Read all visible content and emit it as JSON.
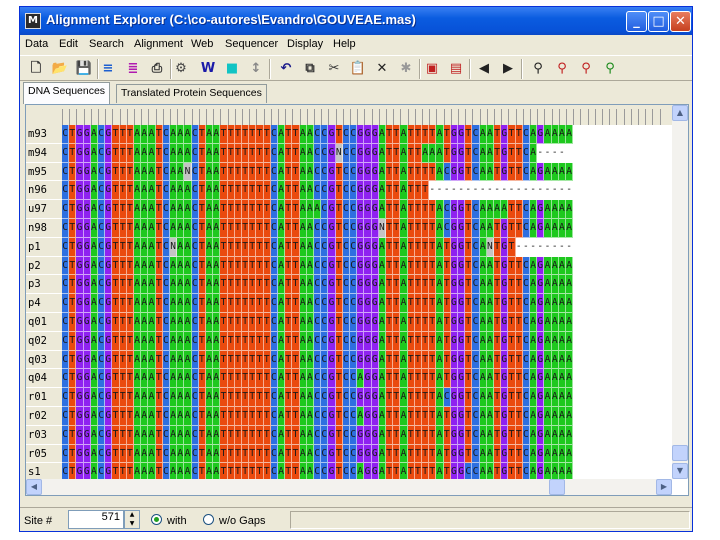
{
  "window": {
    "title": "Alignment Explorer (C:\\co-autores\\Evandro\\GOUVEAE.mas)",
    "icon_name": "mega-app-icon",
    "icon_glyph": "M",
    "minimize_glyph": "_",
    "maximize_glyph": "□",
    "close_glyph": "✕"
  },
  "menu": [
    "Data",
    "Edit",
    "Search",
    "Alignment",
    "Web",
    "Sequencer",
    "Display",
    "Help"
  ],
  "toolbar": [
    {
      "name": "new-file-icon",
      "glyph": "🗋",
      "color": "#333333"
    },
    {
      "name": "open-folder-icon",
      "glyph": "📂",
      "color": "#c48a17"
    },
    {
      "name": "save-disk-icon",
      "glyph": "💾",
      "color": "#2a2a7a"
    },
    {
      "name": "view-wordlist-icon",
      "glyph": "≡",
      "color": "#1d5fd0"
    },
    {
      "name": "align-sequences-icon",
      "glyph": "≣",
      "color": "#b01ab0"
    },
    {
      "name": "print-icon",
      "glyph": "⎙",
      "color": "#333333"
    },
    {
      "name": "translate-codons-icon",
      "glyph": "⚙",
      "color": "#444444"
    },
    {
      "name": "clustal-w-icon",
      "glyph": "W",
      "color": "#1a1aa8"
    },
    {
      "name": "muscle-icon",
      "glyph": "■",
      "color": "#11c4c4"
    },
    {
      "name": "mark-site-icon",
      "glyph": "↕",
      "color": "#888888"
    },
    {
      "name": "undo-icon",
      "glyph": "↶",
      "color": "#1a1a8a"
    },
    {
      "name": "copy-icon",
      "glyph": "⧉",
      "color": "#333333"
    },
    {
      "name": "cut-icon",
      "glyph": "✂",
      "color": "#333333"
    },
    {
      "name": "paste-icon",
      "glyph": "📋",
      "color": "#8a6a2a"
    },
    {
      "name": "delete-icon",
      "glyph": "✕",
      "color": "#222222"
    },
    {
      "name": "delete-gap-icon",
      "glyph": "✱",
      "color": "#999999"
    },
    {
      "name": "add-sequence-icon",
      "glyph": "▣",
      "color": "#c02020"
    },
    {
      "name": "edit-sequence-icon",
      "glyph": "▤",
      "color": "#c02020"
    },
    {
      "name": "previous-site-icon",
      "glyph": "◀",
      "color": "#222222"
    },
    {
      "name": "next-site-icon",
      "glyph": "▶",
      "color": "#222222"
    },
    {
      "name": "find-icon",
      "glyph": "⚲",
      "color": "#222222"
    },
    {
      "name": "find-previous-icon",
      "glyph": "⚲",
      "color": "#c02020"
    },
    {
      "name": "find-next-icon",
      "glyph": "⚲",
      "color": "#c02020"
    },
    {
      "name": "find-motif-icon",
      "glyph": "⚲",
      "color": "#1a8a1a"
    }
  ],
  "tabs": [
    "DNA Sequences",
    "Translated Protein Sequences"
  ],
  "base_colors": {
    "A": "#1ec81e",
    "C": "#2e6fe0",
    "G": "#8f22f0",
    "T": "#ea4a0e",
    "N": "#c4c4c4",
    "-": "#ffffff"
  },
  "sequences": [
    {
      "name": "m93",
      "seq": "CTGGACGTTTAAATCAAACTAATTTTTTTCATTAACCGTCCGGGATTATTTTATGGTCAATGTTCAGAAAA"
    },
    {
      "name": "m94",
      "seq": "CTGGACGTTTAAATCAAACTAATTTTTTTCATTAACCGNCCGGGATTATTAAATGGTCAATGTTCA----"
    },
    {
      "name": "m95",
      "seq": "CTGGACGTTTAAATCAANCTAATTTTTTTCATTAACCGTCCGGGATTATTTTACGGTCAATGTTCAGAAAA"
    },
    {
      "name": "n96",
      "seq": "CTGGACGTTTAAATCAAACTAATTTTTTTCATTAACCGTCCGGGATTATTT--------------------"
    },
    {
      "name": "u97",
      "seq": "CTGGACGTTTAAATCAAACTAATTTTTTTCATTAAACGTCCGGGATTATTTTACGGTCAAAATTCAGAAAA"
    },
    {
      "name": "n98",
      "seq": "CTGGACGTTTAAATCAAACTAATTTTTTTCATTAACCGTCCGGGNTTATTTTACGGTCAATGTTCAGAAAA"
    },
    {
      "name": "p1",
      "seq": "CTGGACGTTTAAATCNAACTAATTTTTTTCATTAACCGTCCGGGATTATTTTATGGTCANTGT--------"
    },
    {
      "name": "p2",
      "seq": "CTGGACGTTTAAATCAAACTAATTTTTTTCATTAACCGTCCGGGATTATTTTATGGTCAATGTTCAGAAAA"
    },
    {
      "name": "p3",
      "seq": "CTGGACGTTTAAATCAAACTAATTTTTTTCATTAACCGTCCGGGATTATTTTATGGTCAATGTTCAGAAAA"
    },
    {
      "name": "p4",
      "seq": "CTGGACGTTTAAATCAAACTAATTTTTTTCATTAACCGTCCGGGATTATTTTATGGTCAATGTTCAGAAAA"
    },
    {
      "name": "q01",
      "seq": "CTGGACGTTTAAATCAAACTAATTTTTTTCATTAACCGTCCGGGATTATTTTATGGTCAATGTTCAGAAAA"
    },
    {
      "name": "q02",
      "seq": "CTGGACGTTTAAATCAAACTAATTTTTTTCATTAACCGTCCGGGATTATTTTATGGTCAATGTTCAGAAAA"
    },
    {
      "name": "q03",
      "seq": "CTGGACGTTTAAATCAAACTAATTTTTTTCATTAACCGTCCGGGATTATTTTATGGTCAATGTTCAGAAAA"
    },
    {
      "name": "q04",
      "seq": "CTGGACGTTTAAATCAAACTAATTTTTTTCATTAACCGTCCAGGATTATTTTATGGTCAATGTTCAGAAAA"
    },
    {
      "name": "r01",
      "seq": "CTGGACGTTTAAATCAAACTAATTTTTTTCATTAACCGTCCGGGATTATTTTACGGTCAATGTTCAGAAAA"
    },
    {
      "name": "r02",
      "seq": "CTGGACGTTTAAATCAAACTAATTTTTTTCATTAACCGTCCAGGATTATTTTATGGTCAATGTTCAGAAAA"
    },
    {
      "name": "r03",
      "seq": "CTGGACGTTTAAATCAAACTAATTTTTTTCATTAACCGTCCGGGATTATTTTATGGTCAATGTTCAGAAAA"
    },
    {
      "name": "r05",
      "seq": "CTGGACGTTTAAATCAAACTAATTTTTTTCATTAACCGTCCGGGATTATTTTATGGTCAATGTTCAGAAAA"
    },
    {
      "name": "s1",
      "seq": "CTGGACGTTTAAATCAAACTAATTTTTTTCATTAACCGTCCAGGATTATTTTATGGCCAATGTTCAGAAAA"
    }
  ],
  "status": {
    "site_label": "Site #",
    "site_value": "571",
    "with_label": "with",
    "without_label": "w/o Gaps",
    "with_checked": true
  },
  "scroll_icons": {
    "up": "▲",
    "down": "▼",
    "left": "◀",
    "right": "▶"
  }
}
